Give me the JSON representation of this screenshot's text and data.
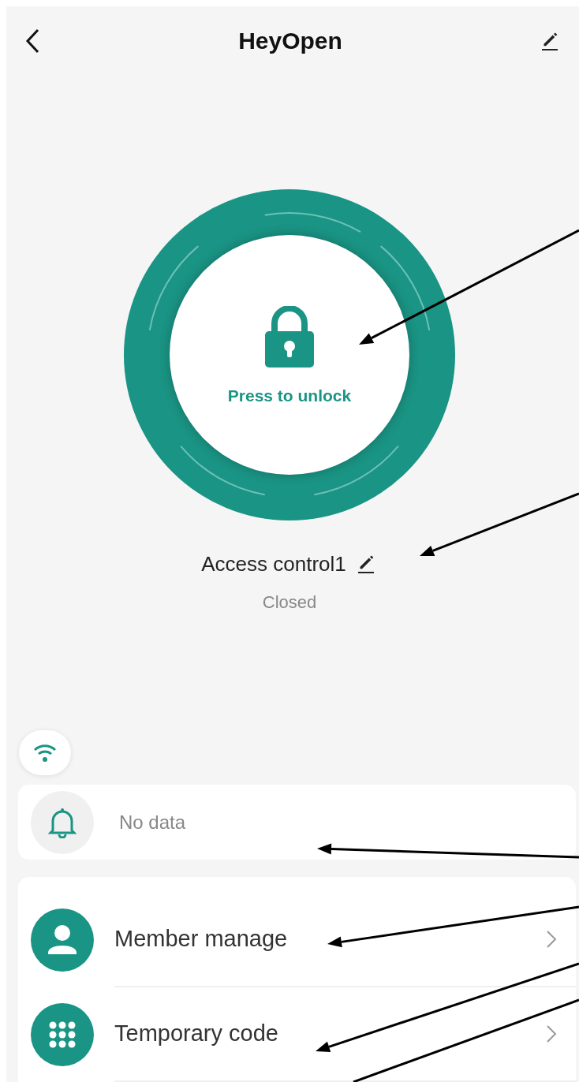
{
  "header": {
    "title": "HeyOpen"
  },
  "unlock": {
    "label": "Press to unlock"
  },
  "device": {
    "name": "Access control1",
    "status": "Closed"
  },
  "notification": {
    "text": "No data"
  },
  "menu": [
    {
      "label": "Member manage",
      "kind": "person"
    },
    {
      "label": "Temporary code",
      "kind": "keypad"
    }
  ]
}
